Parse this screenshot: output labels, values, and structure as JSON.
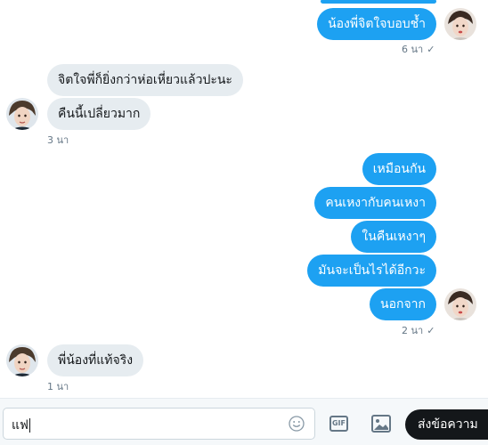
{
  "messages": [
    {
      "id": "m1",
      "direction": "out",
      "text": "น้องพี่จิตใจบอบช้ำ"
    },
    {
      "id": "m2",
      "direction": "in",
      "text": "จิตใจพี่ก็ยิ่งกว่าห่อเหี่ยวแล้วปะนะ"
    },
    {
      "id": "m3",
      "direction": "in",
      "text": "คืนนี้เปลี่ยวมาก"
    },
    {
      "id": "m4",
      "direction": "out",
      "text": "เหมือนกัน"
    },
    {
      "id": "m5",
      "direction": "out",
      "text": "คนเหงากับคนเหงา"
    },
    {
      "id": "m6",
      "direction": "out",
      "text": "ในคืนเหงาๆ"
    },
    {
      "id": "m7",
      "direction": "out",
      "text": "มันจะเป็นไรได้อีกวะ"
    },
    {
      "id": "m8",
      "direction": "out",
      "text": "นอกจาก"
    },
    {
      "id": "m9",
      "direction": "in",
      "text": "พี่น้องที่แท้จริง"
    }
  ],
  "timestamps": {
    "t1": "6 นา",
    "t2": "3 นา",
    "t3": "2 นา",
    "t4": "1 นา"
  },
  "read_check": "✓",
  "composer": {
    "input_value": "แฟ",
    "gif_label": "GIF",
    "send_label": "ส่งข้อความ"
  },
  "icons": {
    "emoji": "smiley-icon",
    "gif": "gif-icon",
    "media": "image-icon"
  },
  "colors": {
    "outgoing_bubble": "#1da1f2",
    "incoming_bubble": "#e6ecf0",
    "send_button": "#14171a",
    "meta_text": "#657786"
  }
}
